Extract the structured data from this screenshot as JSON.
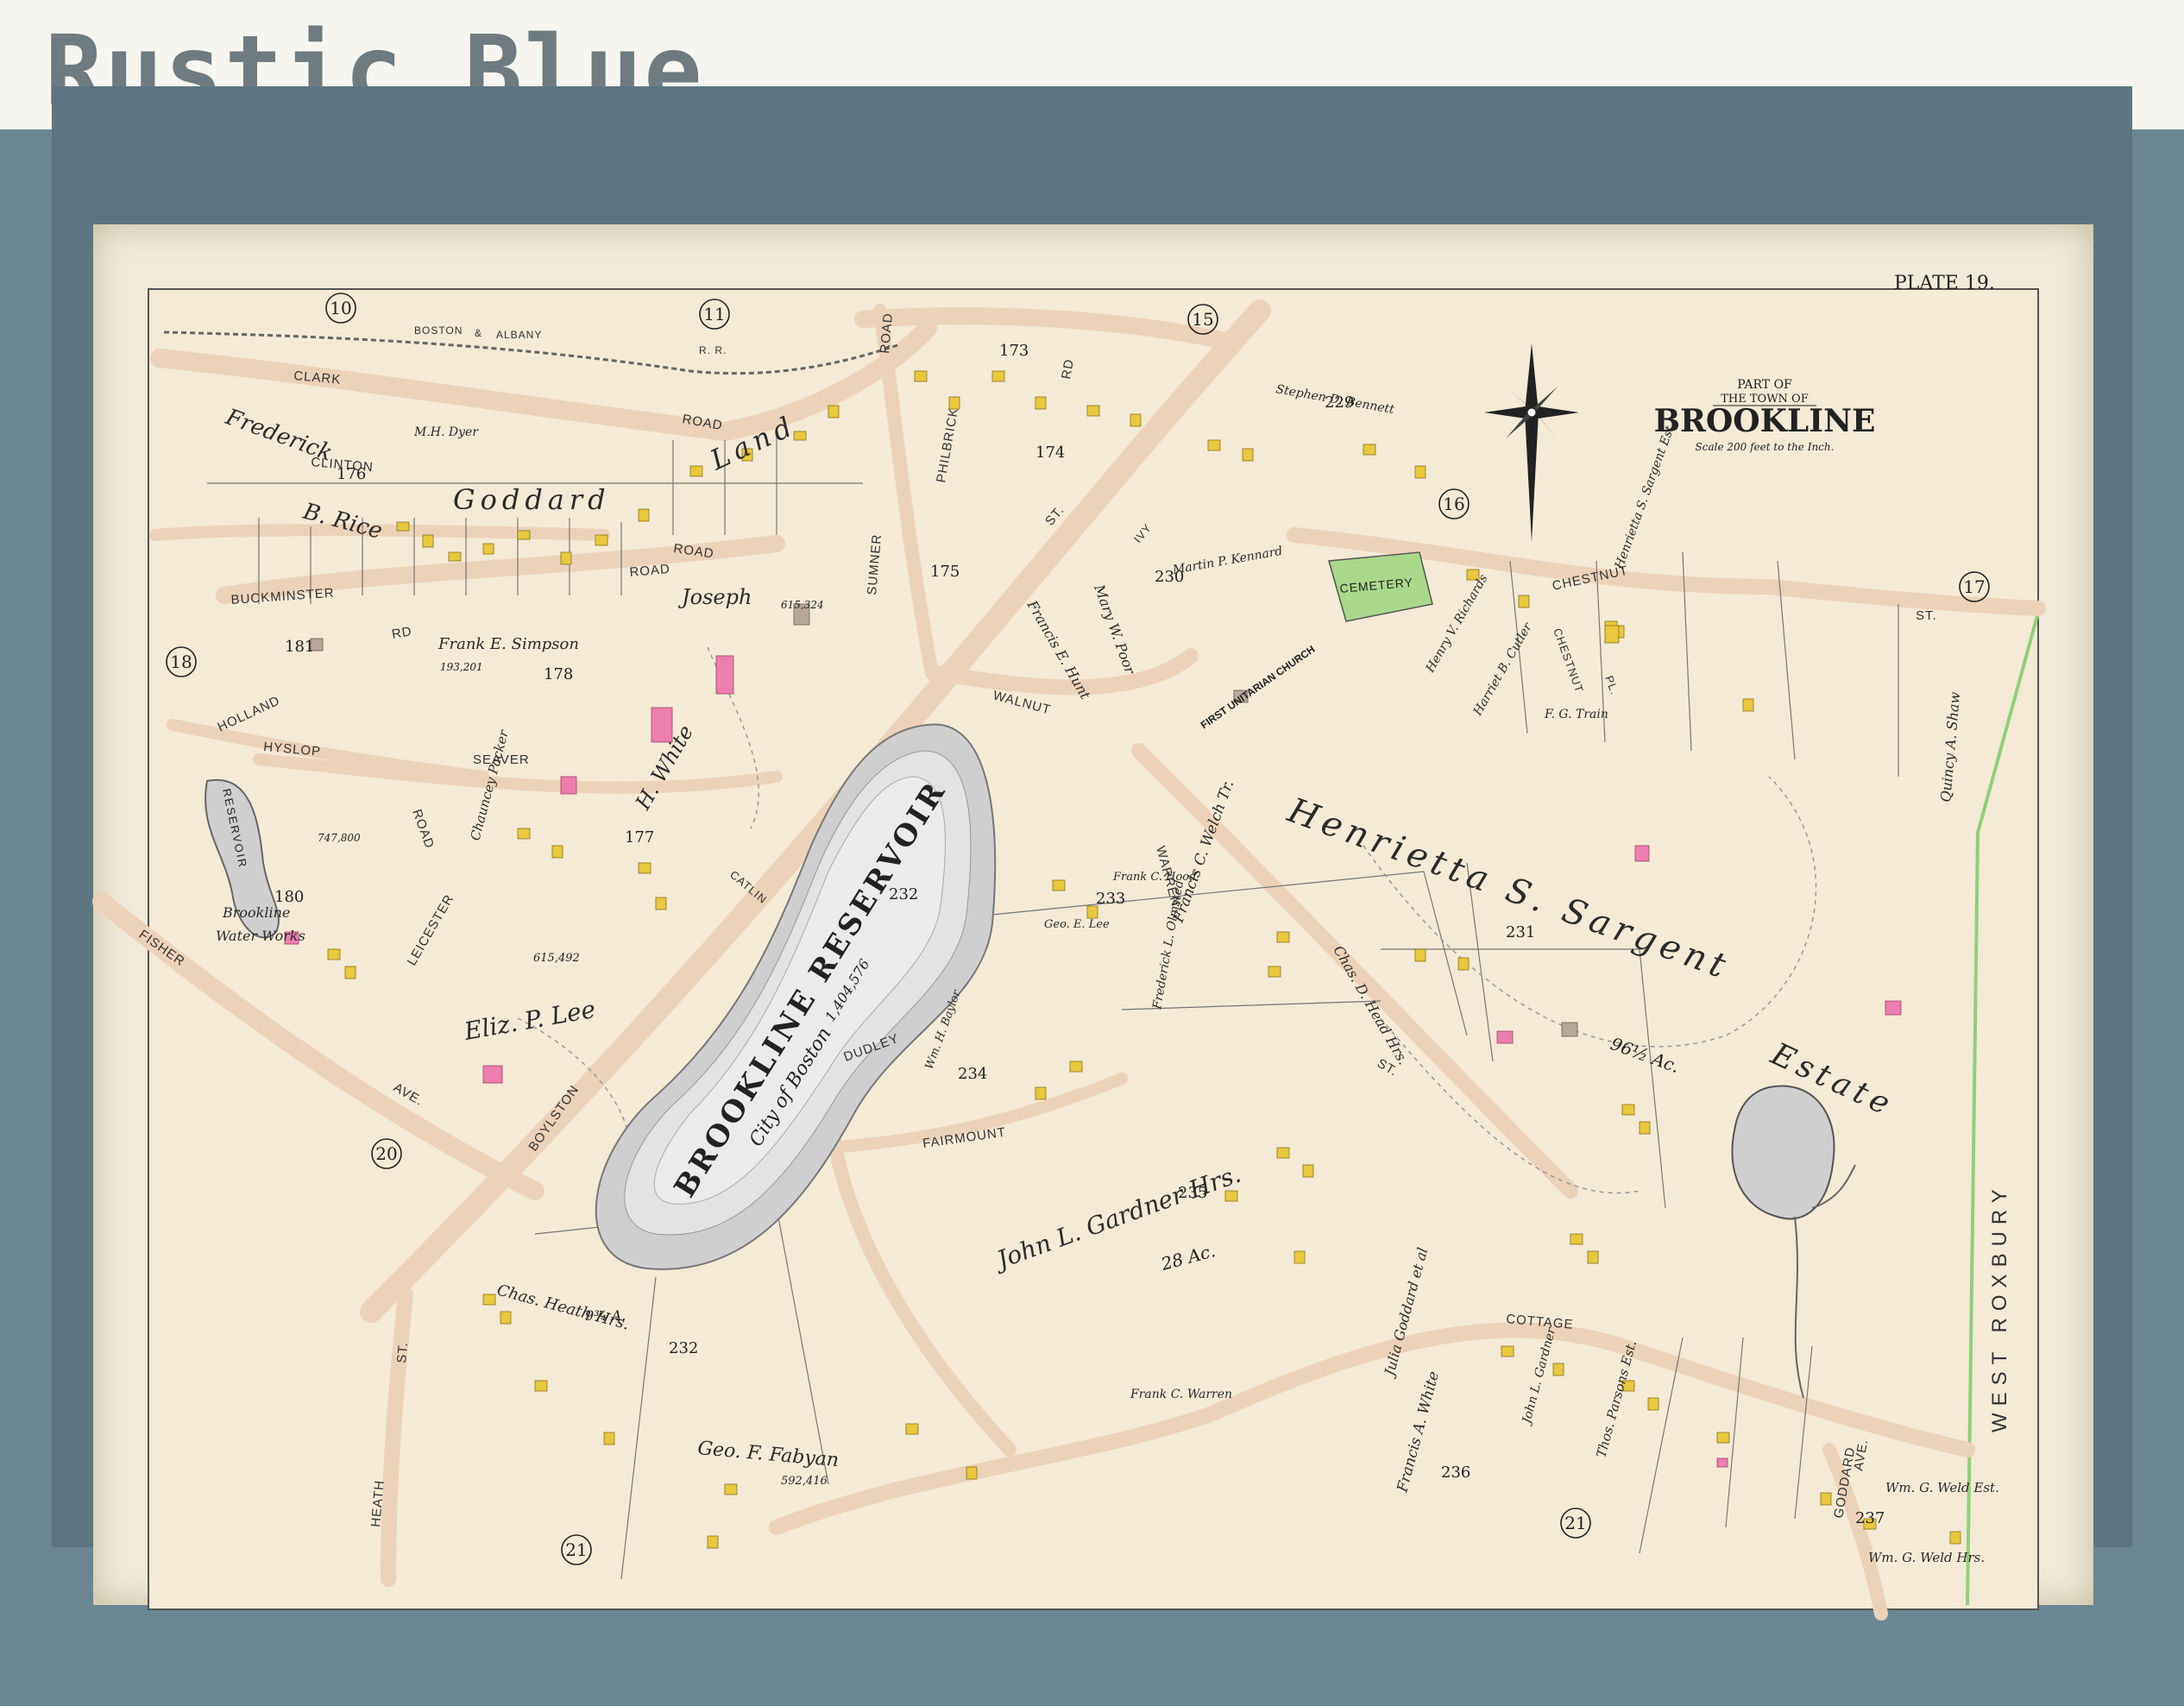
{
  "header": {
    "title": "Rustic Blue"
  },
  "map": {
    "plate": "PLATE 19.",
    "cartouche": {
      "line1": "PART OF",
      "line2": "THE TOWN OF",
      "town": "BROOKLINE",
      "scale": "Scale 200 feet to the Inch."
    },
    "plate_refs": [
      "10",
      "11",
      "15",
      "16",
      "17",
      "18",
      "20",
      "21",
      "21"
    ],
    "section_numbers": [
      "176",
      "173",
      "174",
      "175",
      "181",
      "178",
      "177",
      "180",
      "229",
      "230",
      "231",
      "232",
      "233",
      "234",
      "235",
      "236",
      "237",
      "232"
    ],
    "streets": [
      "CLARK",
      "ROAD",
      "CLINTON",
      "ROAD",
      "BUCKMINSTER",
      "ROAD",
      "HOLLAND",
      "RD",
      "HYSLOP",
      "SEAVER",
      "ROAD",
      "LEICESTER",
      "BOYLSTON",
      "FISHER",
      "AVE.",
      "SUMNER",
      "ROAD",
      "WALNUT",
      "ST.",
      "WARREN",
      "ST.",
      "CHESTNUT",
      "ST.",
      "DUDLEY",
      "FAIRMOUNT",
      "COTTAGE",
      "HEATH",
      "ST.",
      "GODDARD",
      "AVE.",
      "PHILBRICK",
      "RD",
      "BOSTON",
      "&",
      "ALBANY",
      "R. R.",
      "WEST ROXBURY",
      "CATLIN",
      "CHESTNUT",
      "PL.",
      "IVY"
    ],
    "owners": [
      "Frederick",
      "B. Rice",
      "M.H. Dyer",
      "Goddard",
      "Land",
      "Frank E. Simpson",
      "Joseph",
      "H. White",
      "Eliz. P. Lee",
      "Brookline",
      "Water Works",
      "Chas. Heath Hrs.",
      "Geo. F. Fabyan",
      "John L. Gardner Hrs.",
      "Henrietta S. Sargent",
      "Estate",
      "Francis C. Welch Tr.",
      "Chas. D. Head Hrs.",
      "Mary W. Poor",
      "Francis E. Hunt",
      "Quincy A. Shaw",
      "Wm. G. Weld Est.",
      "Wm. G. Weld Hrs.",
      "Francis A. White",
      "Julia Goddard et al",
      "Thos. Parsons Est.",
      "John L. Gardner",
      "Frank C. Warren",
      "Chauncey Packer",
      "Stephen D. Bennett",
      "Henrietta S. Sargent Est.",
      "Henry V. Richards",
      "Harriet B. Cutler",
      "F. G. Train",
      "Martin P. Kennard",
      "Frank C. Hood",
      "Frederick L. Olmsted",
      "Geo. E. Lee",
      "Wm. H. Baylor"
    ],
    "features": {
      "reservoir": "BROOKLINE RESERVOIR",
      "reservoir_sub": "City of Boston",
      "reservoir_area": "1,404,576",
      "small_reservoir": "RESERVOIR",
      "cemetery": "CEMETERY",
      "church": "FIRST UNITARIAN CHURCH",
      "area_sargent": "96½ Ac.",
      "area_gardner": "28 Ac.",
      "area_heath": "9¾ A.",
      "area_lee": "615,492",
      "area_fabyan": "592,416",
      "area_white": "615,324",
      "area_rice": "747,800",
      "area_simpson": "193,201"
    },
    "colors": {
      "paper": "#f1ead8",
      "road": "#ecd2b8",
      "building_yellow": "#e8c83c",
      "building_pink": "#ec7fae",
      "building_gray": "#b7a89a",
      "water": "#c9c9c9",
      "green": "#a9d88b",
      "frame": "#6a8793"
    }
  }
}
